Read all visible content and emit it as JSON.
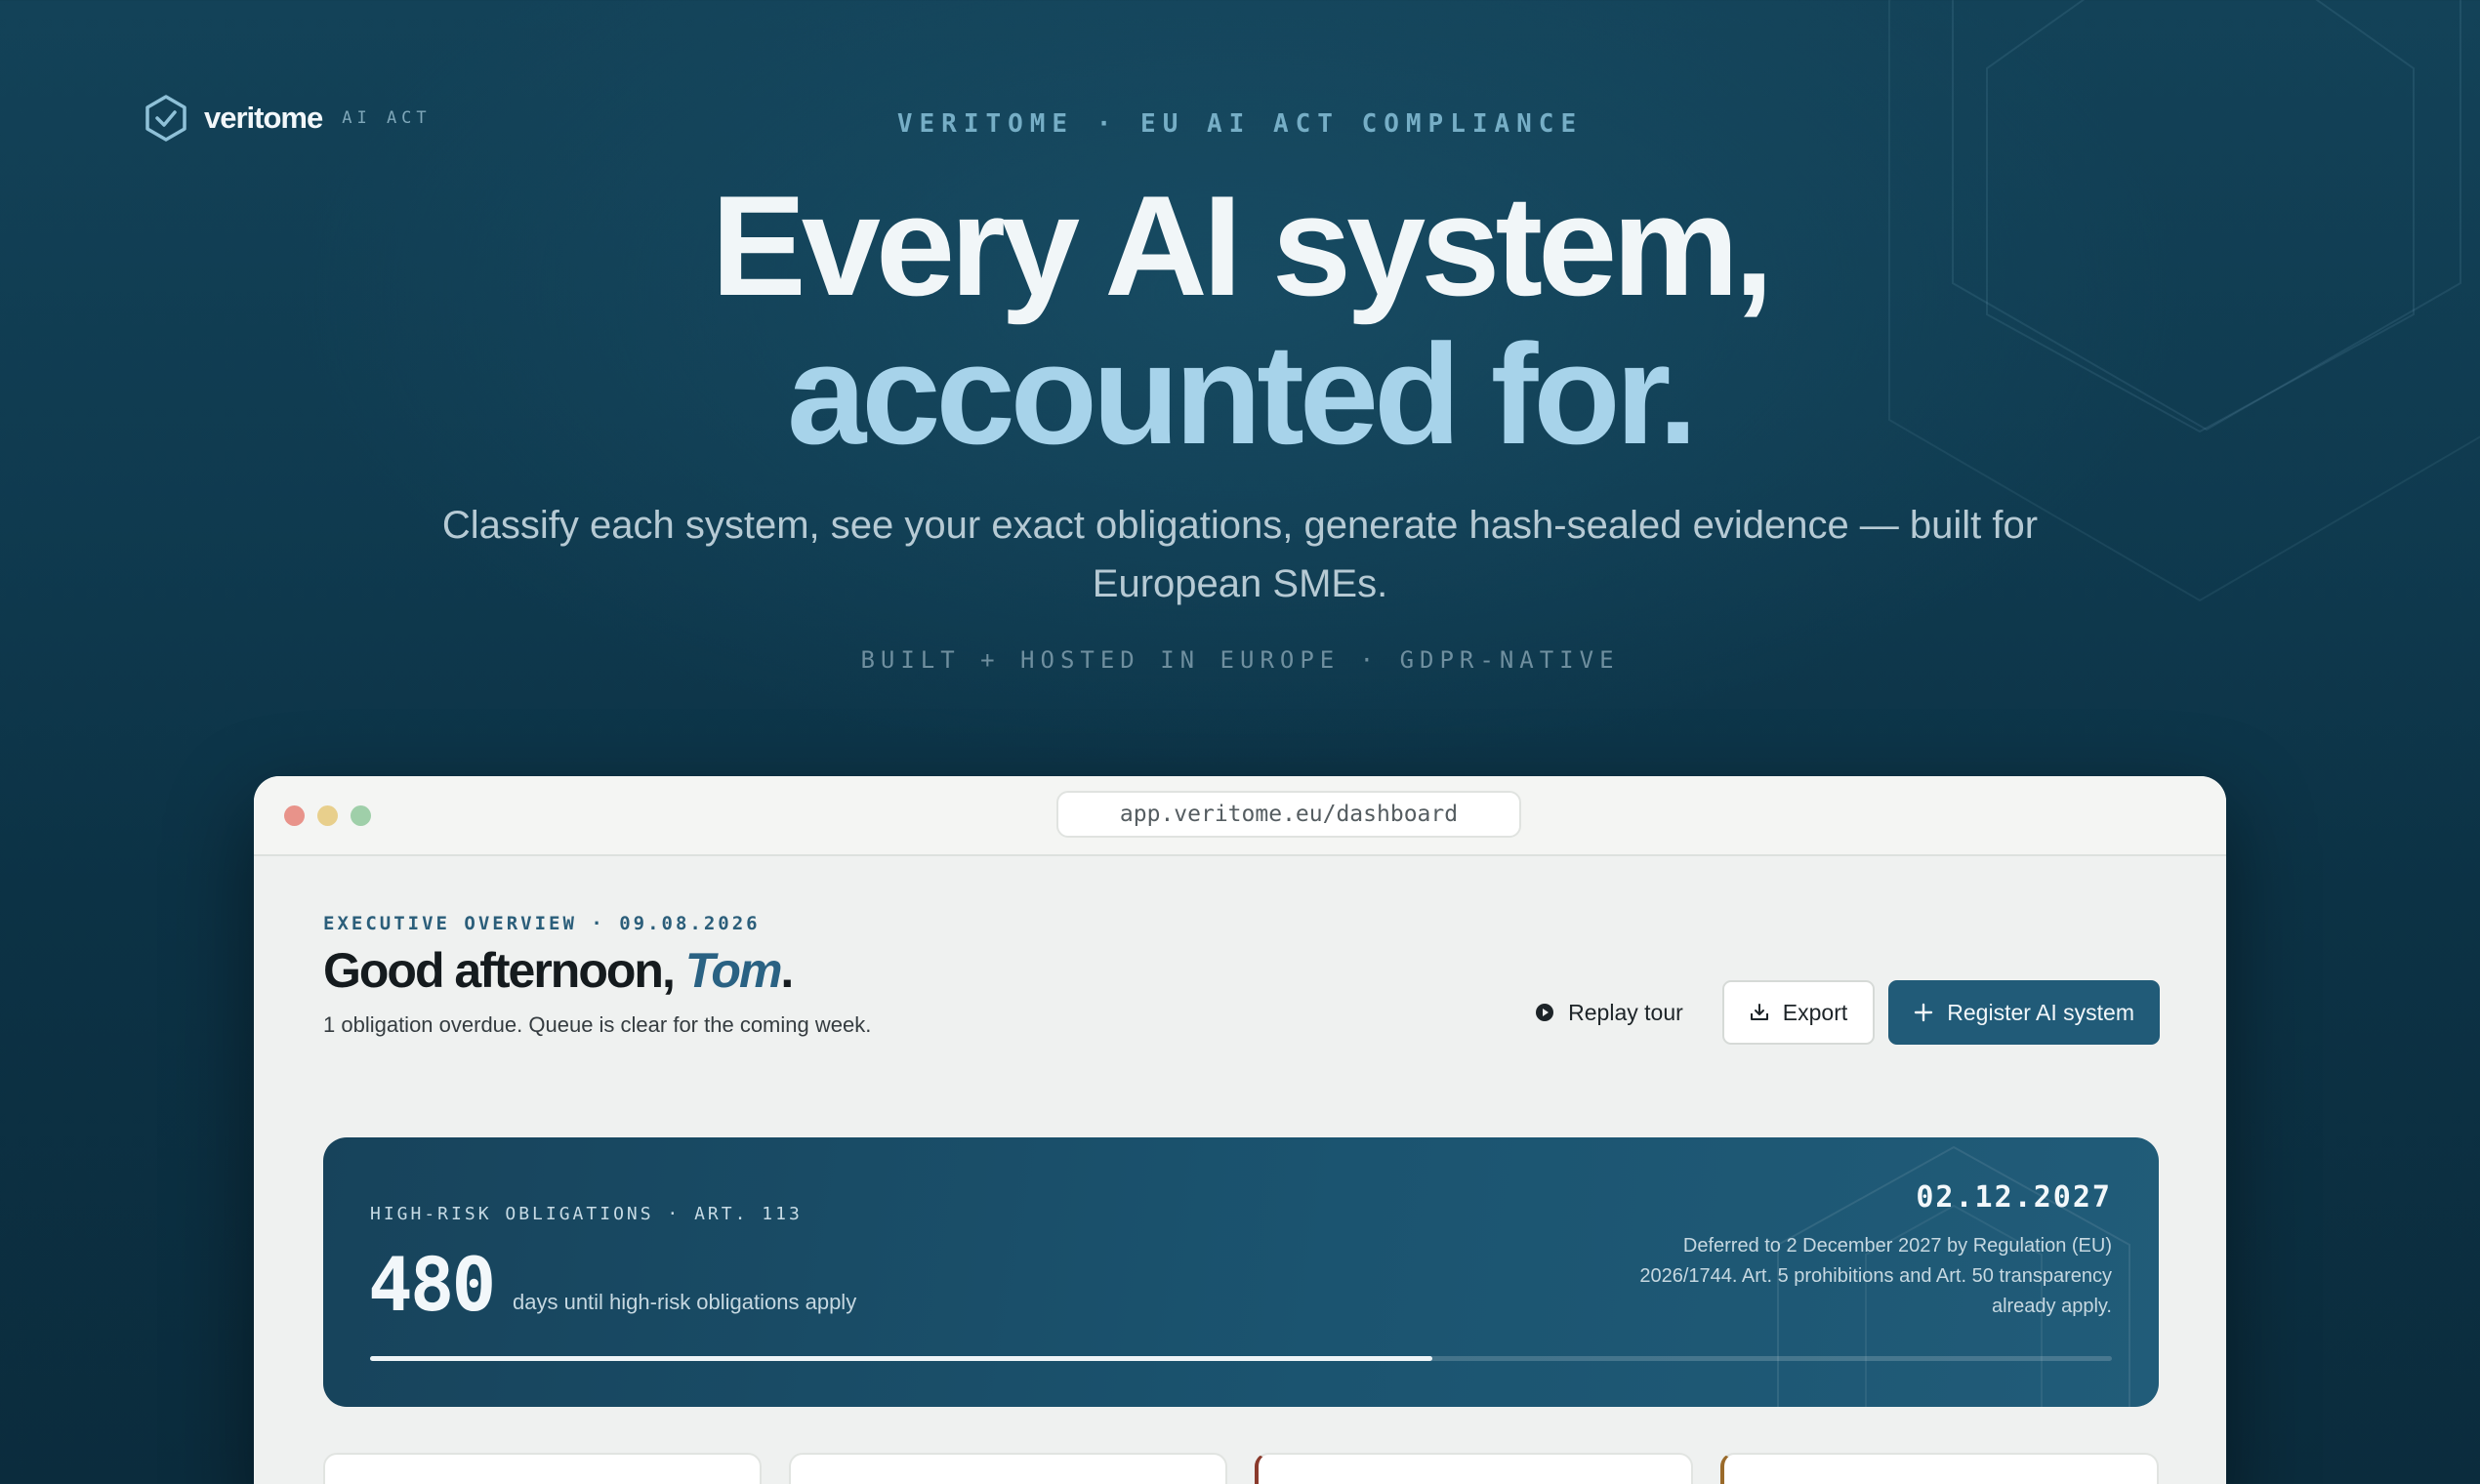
{
  "brand": {
    "name": "veritome",
    "tag": "AI ACT"
  },
  "hero": {
    "eyebrow": "VERITOME · EU AI ACT COMPLIANCE",
    "title_line1": "Every AI system,",
    "title_line2": "accounted for.",
    "subtitle": "Classify each system, see your exact obligations, generate hash-sealed evidence — built for European SMEs.",
    "meta": "BUILT + HOSTED IN EUROPE · GDPR-NATIVE"
  },
  "browser": {
    "url": "app.veritome.eu/dashboard"
  },
  "dashboard": {
    "eyebrow": "EXECUTIVE OVERVIEW · 09.08.2026",
    "greeting_prefix": "Good afternoon, ",
    "greeting_name": "Tom",
    "greeting_suffix": ".",
    "status": "1 obligation overdue. Queue is clear for the coming week.",
    "actions": {
      "replay_tour": "Replay tour",
      "export": "Export",
      "register": "Register AI system"
    },
    "deadline_card": {
      "label": "HIGH-RISK OBLIGATIONS · ART. 113",
      "days": "480",
      "days_label": "days until high-risk obligations apply",
      "date": "02.12.2027",
      "note": "Deferred to 2 December 2027 by Regulation (EU) 2026/1744. Art. 5 prohibitions and Art. 50 transparency already apply.",
      "progress_fraction": 0.61
    }
  },
  "colors": {
    "accent": "#215b78",
    "hero_highlight": "#a7d3ea",
    "greeting_name": "#2a6283"
  }
}
